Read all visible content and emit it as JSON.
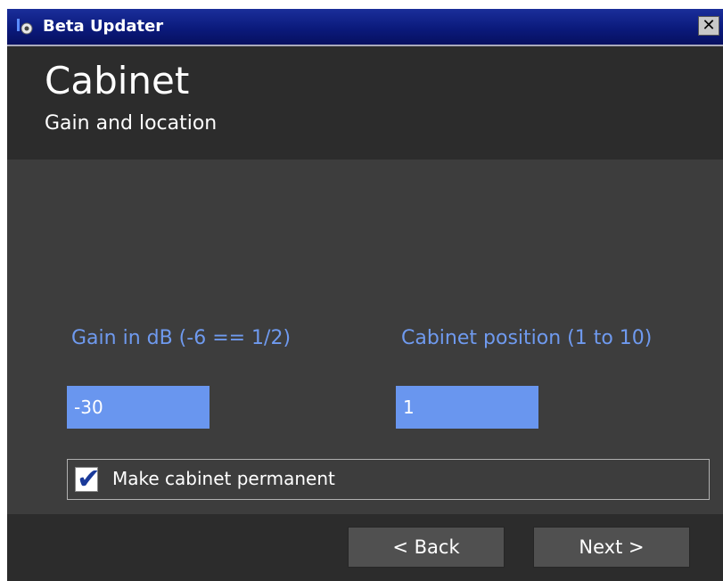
{
  "window": {
    "title": "Beta Updater",
    "close_glyph": "✕"
  },
  "header": {
    "title": "Cabinet",
    "subtitle": "Gain and location"
  },
  "form": {
    "gain": {
      "label": "Gain in dB (-6 == 1/2)",
      "value": "-30"
    },
    "position": {
      "label": "Cabinet position (1 to 10)",
      "value": "1"
    },
    "permanent": {
      "label": "Make cabinet permanent",
      "checked": true,
      "check_glyph": "✔"
    }
  },
  "footer": {
    "back_label": "< Back",
    "next_label": "Next >"
  },
  "colors": {
    "accent": "#6996ef",
    "label": "#6f9aef",
    "background": "#3d3d3d",
    "header_bg": "#2c2c2c",
    "titlebar": "#0b1a7c"
  }
}
